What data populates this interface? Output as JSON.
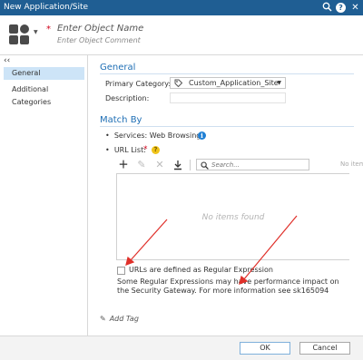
{
  "window": {
    "title": "New Application/Site",
    "icons": [
      "search-icon",
      "help-icon",
      "close-icon"
    ]
  },
  "header": {
    "object_name_placeholder": "Enter Object Name",
    "object_comment_placeholder": "Enter Object Comment",
    "required_mark": "*"
  },
  "sidebar": {
    "collapse_label": "‹‹",
    "items": [
      {
        "label": "General",
        "active": true
      },
      {
        "label": "Additional Categories",
        "active": false
      }
    ]
  },
  "general": {
    "heading": "General",
    "primary_category_label": "Primary Category:",
    "primary_category_value": "Custom_Application_Site",
    "description_label": "Description:"
  },
  "match_by": {
    "heading": "Match By",
    "services_label": "Services: Web Browsing",
    "url_list_label": "URL List:",
    "url_list_required": "*",
    "search_placeholder": "Search...",
    "no_items_small": "No items fou",
    "no_items_big": "No items found",
    "regex_checkbox_label": "URLs are defined as Regular Expression",
    "regex_checkbox_checked": false,
    "performance_note": "Some Regular Expressions may have performance impact on the Security Gateway. For more information see sk165094"
  },
  "add_tag_label": "Add Tag",
  "footer": {
    "ok_label": "OK",
    "cancel_label": "Cancel"
  },
  "colors": {
    "titlebar": "#1f5e93",
    "section_heading": "#1f6fb5",
    "active_nav": "#cde4f7",
    "annotation_arrow": "#e0302a",
    "required": "#d0021b"
  }
}
